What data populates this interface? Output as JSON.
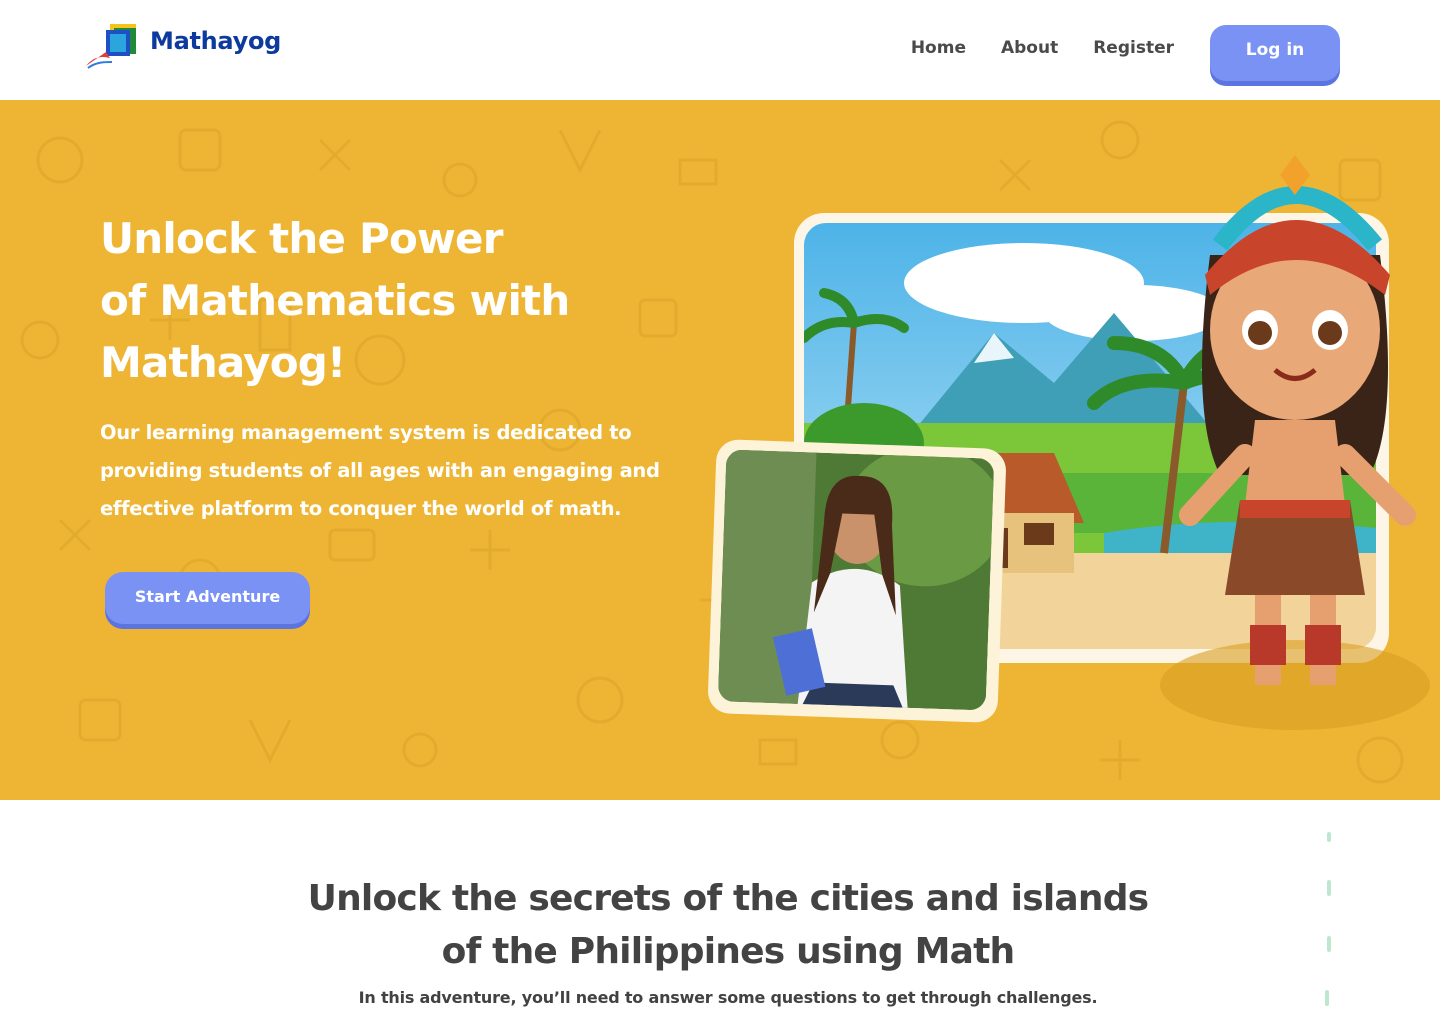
{
  "header": {
    "brand": "Mathayog",
    "nav": [
      {
        "label": "Home"
      },
      {
        "label": "About"
      },
      {
        "label": "Register"
      }
    ],
    "login_label": "Log in"
  },
  "hero": {
    "title_lines": [
      "Unlock the Power",
      "of  Mathematics with",
      "Mathayog!"
    ],
    "description": "Our learning management system is dedicated to providing students of all ages with an engaging and effective platform to conquer the world of math.",
    "cta_label": "Start Adventure",
    "colors": {
      "background": "#eeb534",
      "button": "#7b92f5"
    }
  },
  "section": {
    "title_lines": [
      "Unlock the secrets of the cities and islands",
      "of the Philippines using Math"
    ],
    "description": "In this adventure, you’ll need to answer some questions to get through challenges."
  },
  "colors": {
    "brand": "#0d3a9e",
    "accent": "#7b92f5",
    "hero": "#eeb534"
  }
}
